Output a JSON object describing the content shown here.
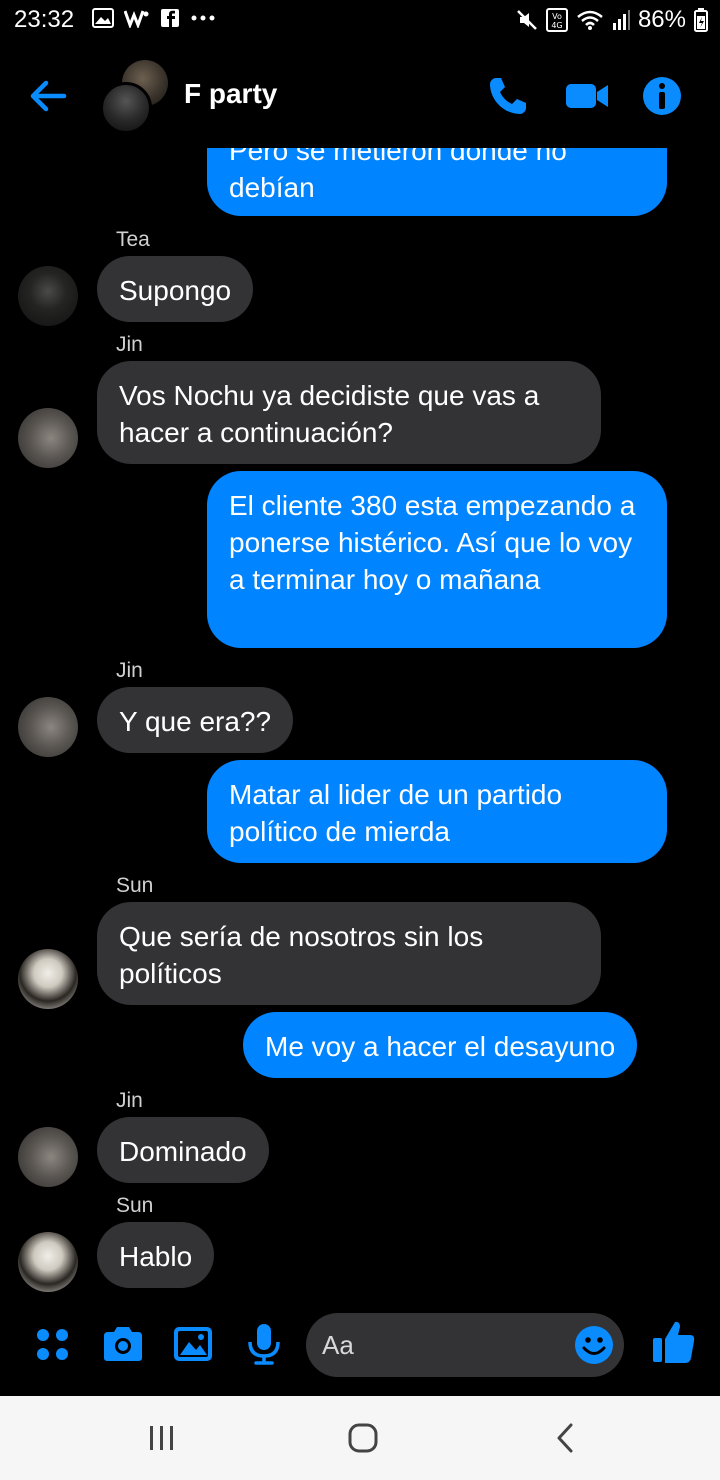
{
  "status_bar": {
    "time": "23:32",
    "battery": "86%",
    "notification_icons": [
      "gallery-icon",
      "wordpress-icon",
      "facebook-icon",
      "more-icon"
    ],
    "system_icons": [
      "mute-icon",
      "volte-icon",
      "wifi-icon",
      "signal-icon",
      "battery-icon"
    ]
  },
  "header": {
    "title": "F party",
    "icons": [
      "back-arrow-icon",
      "phone-icon",
      "video-call-icon",
      "info-icon"
    ]
  },
  "messages": [
    {
      "id": "m1",
      "direction": "out",
      "text": "Pero se metieron donde no debían",
      "partially_cut_off": true
    },
    {
      "id": "m2",
      "direction": "in",
      "sender": "Tea",
      "text": "Supongo"
    },
    {
      "id": "m3",
      "direction": "in",
      "sender": "Jin",
      "text": "Vos Nochu ya decidiste que vas a hacer a continuación?"
    },
    {
      "id": "m4",
      "direction": "out",
      "text": "El cliente 380 esta empezando a ponerse histérico. Así que lo voy a terminar hoy o mañana"
    },
    {
      "id": "m5",
      "direction": "in",
      "sender": "Jin",
      "text": "Y que era??"
    },
    {
      "id": "m6",
      "direction": "out",
      "text": "Matar al lider de un partido político de mierda"
    },
    {
      "id": "m7",
      "direction": "in",
      "sender": "Sun",
      "text": "Que sería de nosotros sin los políticos"
    },
    {
      "id": "m8",
      "direction": "out",
      "text": "Me voy a hacer el desayuno"
    },
    {
      "id": "m9",
      "direction": "in",
      "sender": "Jin",
      "text": "Dominado"
    },
    {
      "id": "m10",
      "direction": "in",
      "sender": "Sun",
      "text": "Hablo"
    }
  ],
  "composer": {
    "placeholder": "Aa",
    "icons": [
      "apps-icon",
      "camera-icon",
      "gallery-icon",
      "microphone-icon",
      "emoji-icon",
      "thumbs-up-icon"
    ]
  },
  "navigation_bar": {
    "buttons": [
      "recent-apps-icon",
      "home-icon",
      "back-icon"
    ]
  },
  "colors": {
    "accent": "#0084ff",
    "background": "#000000",
    "incoming_bubble": "#333336",
    "navbar": "#f6f6f6"
  }
}
